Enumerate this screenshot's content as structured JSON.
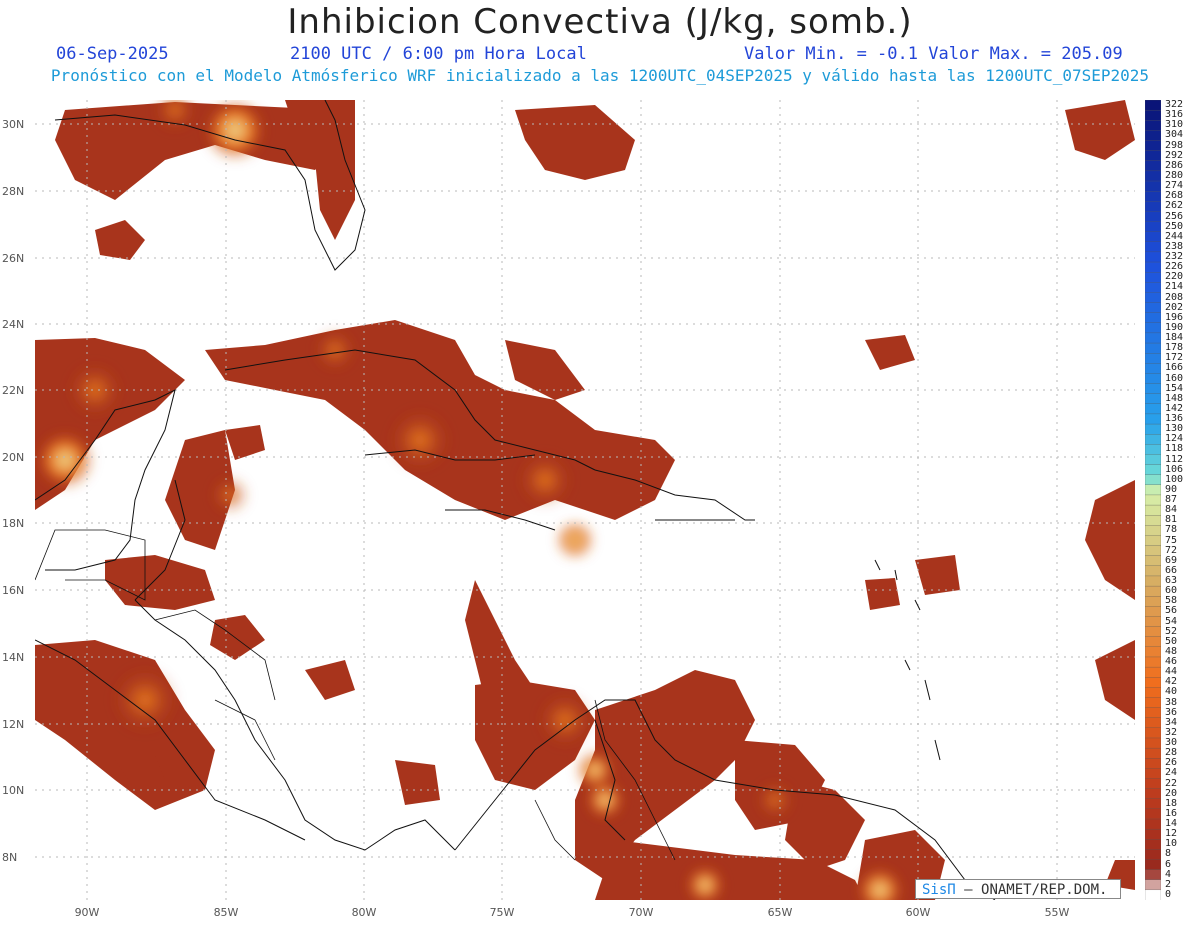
{
  "header": {
    "title": "Inhibicion Convectiva (J/kg, somb.)",
    "date": "06-Sep-2025",
    "time": "2100 UTC / 6:00 pm Hora Local",
    "range": "Valor Min. = -0.1  Valor Max. = 205.09",
    "forecast": "Pronóstico con el Modelo Atmósferico WRF inicializado a las 1200UTC_04SEP2025 y válido hasta las  1200UTC_07SEP2025"
  },
  "axes": {
    "lat_labels": [
      "30N",
      "28N",
      "26N",
      "24N",
      "22N",
      "20N",
      "18N",
      "16N",
      "14N",
      "12N",
      "10N",
      "8N"
    ],
    "lon_labels": [
      "90W",
      "85W",
      "80W",
      "75W",
      "70W",
      "65W",
      "60W",
      "55W"
    ]
  },
  "legend": {
    "labels": [
      "322",
      "316",
      "310",
      "304",
      "298",
      "292",
      "286",
      "280",
      "274",
      "268",
      "262",
      "256",
      "250",
      "244",
      "238",
      "232",
      "226",
      "220",
      "214",
      "208",
      "202",
      "196",
      "190",
      "184",
      "178",
      "172",
      "166",
      "160",
      "154",
      "148",
      "142",
      "136",
      "130",
      "124",
      "118",
      "112",
      "106",
      "100",
      "90",
      "87",
      "84",
      "81",
      "78",
      "75",
      "72",
      "69",
      "66",
      "63",
      "60",
      "58",
      "56",
      "54",
      "52",
      "50",
      "48",
      "46",
      "44",
      "42",
      "40",
      "38",
      "36",
      "34",
      "32",
      "30",
      "28",
      "26",
      "24",
      "22",
      "20",
      "18",
      "16",
      "14",
      "12",
      "10",
      "8",
      "6",
      "4",
      "2",
      "0"
    ]
  },
  "credit": {
    "brand": "SisΠ",
    "text": "– ONAMET/REP.DOM."
  },
  "colors": {
    "field_dark": "#a8341c",
    "field_mid": "#d2541e",
    "field_light": "#e8e4a0",
    "title": "#222222",
    "subtitle": "#2345d8",
    "forecast": "#1e9bd8"
  }
}
